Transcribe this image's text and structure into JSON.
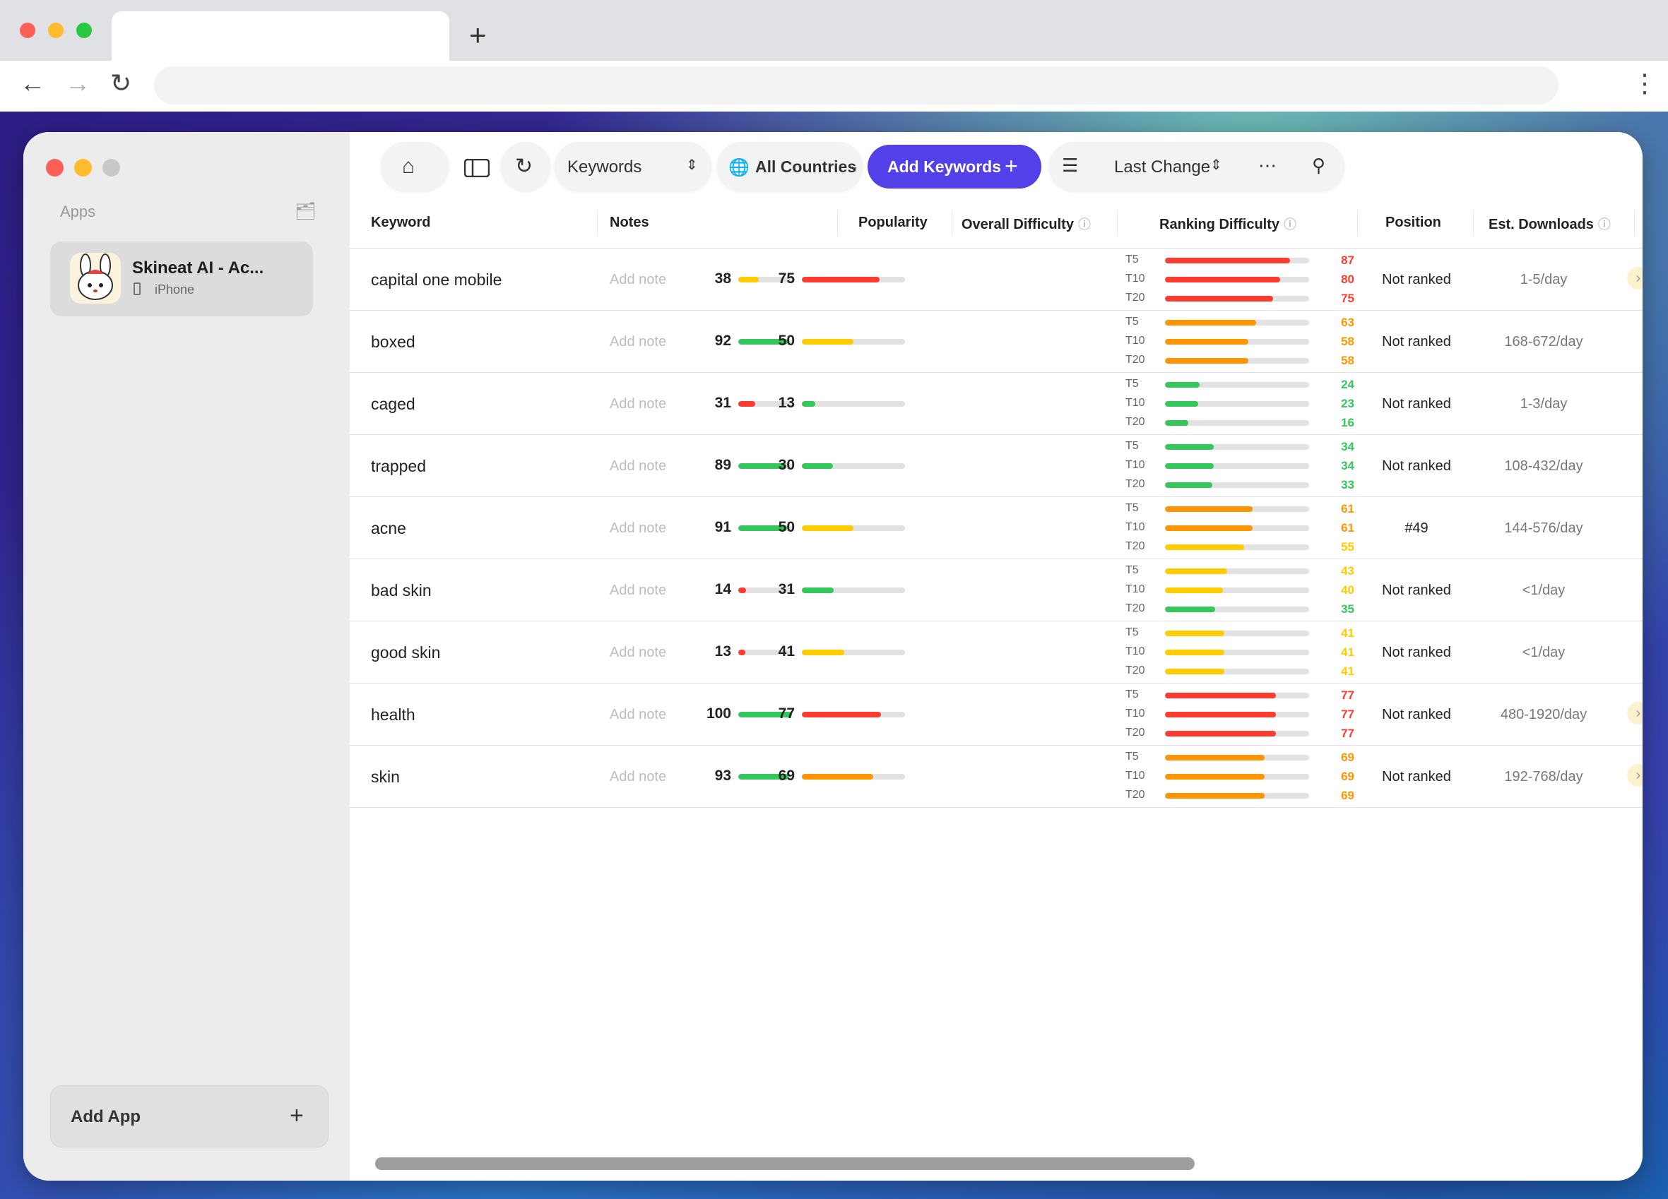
{
  "browser": {
    "new_tab_symbol": "+",
    "back_icon": "arrow-left-icon",
    "forward_icon": "arrow-right-icon",
    "reload_icon": "reload-icon",
    "menu_icon": "kebab-icon"
  },
  "sidebar": {
    "section_label": "Apps",
    "apps": [
      {
        "name": "Skineat AI - Ac...",
        "platform": "iPhone"
      }
    ],
    "add_app_label": "Add App",
    "add_app_symbol": "+"
  },
  "toolbar": {
    "view_select": "Keywords",
    "country_select": "All Countries",
    "add_keywords_label": "Add Keywords",
    "add_keywords_symbol": "+",
    "sort_select": "Last Change"
  },
  "table": {
    "columns": {
      "keyword": "Keyword",
      "notes": "Notes",
      "popularity": "Popularity",
      "overall_difficulty": "Overall Difficulty",
      "ranking_difficulty": "Ranking Difficulty",
      "position": "Position",
      "est_downloads": "Est. Downloads"
    },
    "rank_tiers": [
      "T5",
      "T10",
      "T20"
    ],
    "note_placeholder": "Add note",
    "rows": [
      {
        "keyword": "capital one mobile",
        "popularity": 38,
        "overall": 75,
        "t5": 87,
        "t10": 80,
        "t20": 75,
        "position": "Not ranked",
        "downloads": "1-5/day",
        "arrow": true
      },
      {
        "keyword": "boxed",
        "popularity": 92,
        "overall": 50,
        "t5": 63,
        "t10": 58,
        "t20": 58,
        "position": "Not ranked",
        "downloads": "168-672/day",
        "arrow": false
      },
      {
        "keyword": "caged",
        "popularity": 31,
        "overall": 13,
        "t5": 24,
        "t10": 23,
        "t20": 16,
        "position": "Not ranked",
        "downloads": "1-3/day",
        "arrow": false
      },
      {
        "keyword": "trapped",
        "popularity": 89,
        "overall": 30,
        "t5": 34,
        "t10": 34,
        "t20": 33,
        "position": "Not ranked",
        "downloads": "108-432/day",
        "arrow": false
      },
      {
        "keyword": "acne",
        "popularity": 91,
        "overall": 50,
        "t5": 61,
        "t10": 61,
        "t20": 55,
        "position": "#49",
        "downloads": "144-576/day",
        "arrow": false
      },
      {
        "keyword": "bad skin",
        "popularity": 14,
        "overall": 31,
        "t5": 43,
        "t10": 40,
        "t20": 35,
        "position": "Not ranked",
        "downloads": "<1/day",
        "arrow": false
      },
      {
        "keyword": "good skin",
        "popularity": 13,
        "overall": 41,
        "t5": 41,
        "t10": 41,
        "t20": 41,
        "position": "Not ranked",
        "downloads": "<1/day",
        "arrow": false
      },
      {
        "keyword": "health",
        "popularity": 100,
        "overall": 77,
        "t5": 77,
        "t10": 77,
        "t20": 77,
        "position": "Not ranked",
        "downloads": "480-1920/day",
        "arrow": true
      },
      {
        "keyword": "skin",
        "popularity": 93,
        "overall": 69,
        "t5": 69,
        "t10": 69,
        "t20": 69,
        "position": "Not ranked",
        "downloads": "192-768/day",
        "arrow": true
      }
    ]
  },
  "colors": {
    "accent": "#5340e8",
    "green": "#34c759",
    "yellow": "#ffcc00",
    "orange": "#ff9500",
    "red": "#ff3b30"
  }
}
